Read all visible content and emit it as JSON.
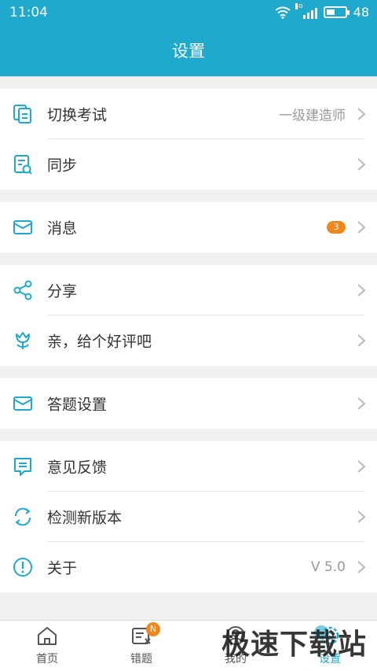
{
  "status": {
    "time": "11:04",
    "network": "4G",
    "battery": "48",
    "battery_level": 0.48
  },
  "header": {
    "title": "设置"
  },
  "groups": [
    {
      "items": [
        {
          "label": "切换考试",
          "value": "一级建造师",
          "icon": "switch-exam-icon"
        },
        {
          "label": "同步",
          "icon": "sync-doc-icon"
        }
      ]
    },
    {
      "items": [
        {
          "label": "消息",
          "badge": "3",
          "icon": "mail-icon"
        }
      ]
    },
    {
      "items": [
        {
          "label": "分享",
          "icon": "share-icon"
        },
        {
          "label": "亲，给个好评吧",
          "icon": "flower-icon"
        }
      ]
    },
    {
      "items": [
        {
          "label": "答题设置",
          "icon": "mail-icon"
        }
      ]
    },
    {
      "items": [
        {
          "label": "意见反馈",
          "icon": "feedback-icon"
        },
        {
          "label": "检测新版本",
          "icon": "refresh-icon"
        },
        {
          "label": "关于",
          "value": "V 5.0",
          "icon": "info-icon"
        }
      ]
    }
  ],
  "tabs": [
    {
      "label": "首页",
      "icon": "home-icon"
    },
    {
      "label": "错题",
      "icon": "wrong-questions-icon",
      "badge": "N"
    },
    {
      "label": "我的",
      "icon": "user-icon"
    },
    {
      "label": "设置",
      "icon": "settings-icon",
      "active": true
    }
  ],
  "watermark": {
    "text": "极速下载站"
  },
  "colors": {
    "primary": "#1fa9cd",
    "badge": "#f0871b",
    "background": "#f0f0f0"
  }
}
